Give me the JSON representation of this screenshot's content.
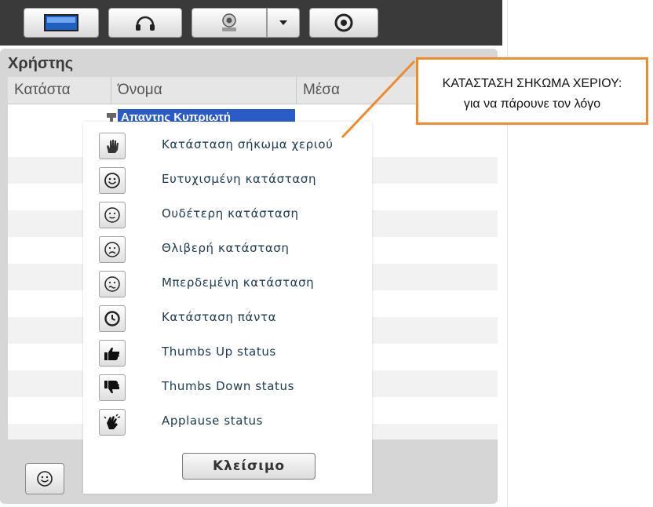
{
  "panel": {
    "title": "Χρήστης",
    "columns": [
      "Κατάστα",
      "Όνομα",
      "Μέσα"
    ],
    "first_row_name": "Απαντης Κυπριωτή"
  },
  "status_menu": {
    "items": [
      {
        "label": "Κατάσταση σήκωμα χεριού",
        "icon": "raise-hand-icon"
      },
      {
        "label": "Ευτυχισμένη κατάσταση",
        "icon": "happy-face-icon"
      },
      {
        "label": "Ουδέτερη κατάσταση",
        "icon": "neutral-face-icon"
      },
      {
        "label": "Θλιβερή κατάσταση",
        "icon": "sad-face-icon"
      },
      {
        "label": "Μπερδεμένη κατάσταση",
        "icon": "confused-face-icon"
      },
      {
        "label": "Κατάσταση πάντα",
        "icon": "clock-icon"
      },
      {
        "label": "Thumbs Up status",
        "icon": "thumbs-up-icon"
      },
      {
        "label": "Thumbs Down status",
        "icon": "thumbs-down-icon"
      },
      {
        "label": "Applause status",
        "icon": "applause-icon"
      }
    ],
    "close_label": "Κλείσιμο"
  },
  "toolbar": {
    "buttons": [
      "screen-share-icon",
      "headset-icon",
      "webcam-icon",
      "dropdown-arrow-icon",
      "record-icon"
    ]
  },
  "annotation": {
    "line1": "ΚΑΤΑΣΤΑΣΗ ΣΗΚΩΜΑ ΧΕΡΙΟΥ:",
    "line2": "για να πάρουνε τον λόγο",
    "border_color": "#f08a2a"
  },
  "colors": {
    "toolbar_bg": "#3a3a3a",
    "panel_bg": "#d6d6d6",
    "menu_text": "#1e3a50",
    "name_highlight": "#2a5bc9"
  }
}
